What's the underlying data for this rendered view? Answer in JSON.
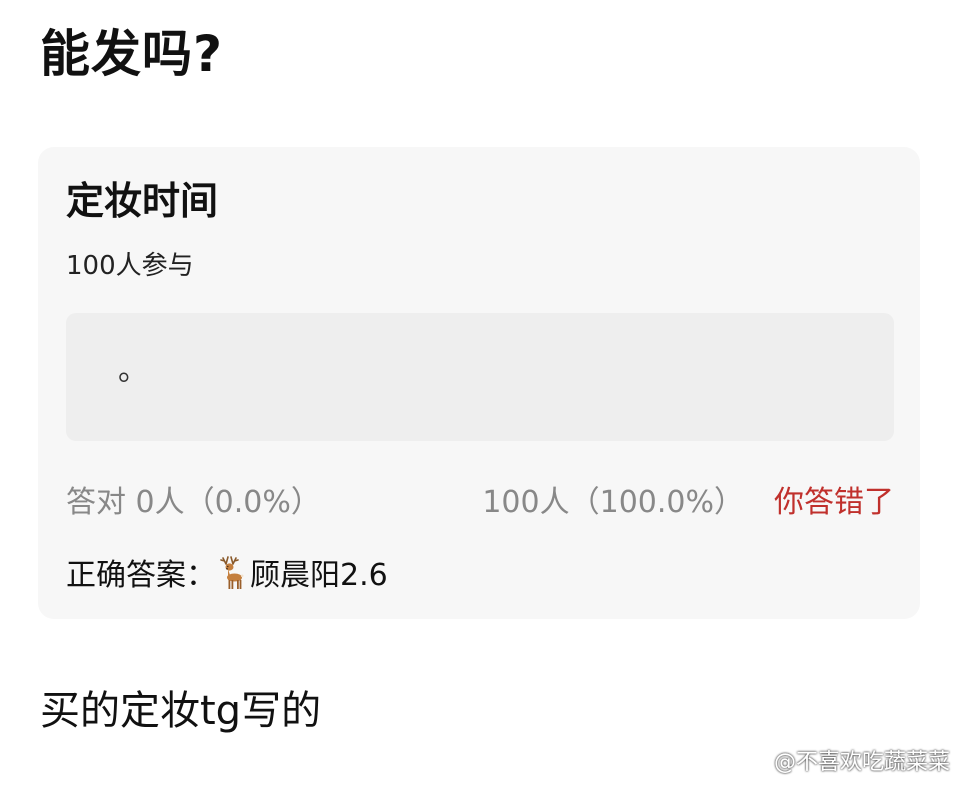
{
  "post": {
    "title": "能发吗?",
    "footer_text": "买的定妆tg写的"
  },
  "quiz": {
    "title": "定妆时间",
    "participants": "100人参与",
    "option_text": "。",
    "correct_stat": "答对  0人（0.0%）",
    "wrong_stat": "100人（100.0%）",
    "wrong_label": "你答错了",
    "correct_answer_label": "正确答案：",
    "correct_answer_value": "顾晨阳2.6",
    "correct_answer_icon": "deer-icon"
  },
  "watermark": {
    "text": "@不喜欢吃蔬菜菜",
    "icon": "weibo-icon"
  },
  "colors": {
    "card_background": "#f7f7f7",
    "answer_box_background": "#eeeeee",
    "wrong_red": "#c0302c",
    "muted_gray": "#888888"
  }
}
